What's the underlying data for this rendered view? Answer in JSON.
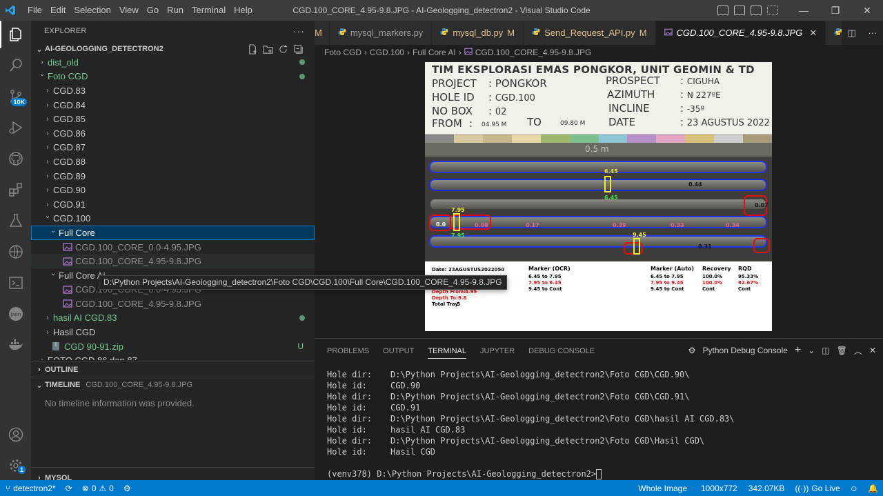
{
  "titlebar": {
    "menu": [
      "File",
      "Edit",
      "Selection",
      "View",
      "Go",
      "Run",
      "Terminal",
      "Help"
    ],
    "title": "CGD.100_CORE_4.95-9.8.JPG - AI-Geologging_detectron2 - Visual Studio Code"
  },
  "activitybar": {
    "items": [
      "explorer-icon",
      "search-icon",
      "source-control-icon",
      "run-debug-icon",
      "github-icon",
      "extensions-icon",
      "testing-icon",
      "remote-explorer-icon",
      "terminal-icon",
      "json-icon",
      "docker-icon",
      "account-icon",
      "settings-icon"
    ],
    "scm_badge": "10K",
    "settings_badge": "1"
  },
  "sidebar": {
    "header": "EXPLORER",
    "root": "AI-GEOLOGGING_DETECTRON2",
    "tree": [
      {
        "label": "dist_old",
        "level": 1,
        "chev": "›",
        "git": true,
        "dot": true
      },
      {
        "label": "Foto CGD",
        "level": 1,
        "chev": "⌄",
        "git": true,
        "dot": true
      },
      {
        "label": "CGD.83",
        "level": 2,
        "chev": "›"
      },
      {
        "label": "CGD.84",
        "level": 2,
        "chev": "›"
      },
      {
        "label": "CGD.85",
        "level": 2,
        "chev": "›"
      },
      {
        "label": "CGD.86",
        "level": 2,
        "chev": "›"
      },
      {
        "label": "CGD.87",
        "level": 2,
        "chev": "›"
      },
      {
        "label": "CGD.88",
        "level": 2,
        "chev": "›"
      },
      {
        "label": "CGD.89",
        "level": 2,
        "chev": "›"
      },
      {
        "label": "CGD.90",
        "level": 2,
        "chev": "›"
      },
      {
        "label": "CGD.91",
        "level": 2,
        "chev": "›"
      },
      {
        "label": "CGD.100",
        "level": 2,
        "chev": "⌄"
      },
      {
        "label": "Full Core",
        "level": 3,
        "chev": "⌄",
        "selected": true
      },
      {
        "label": "CGD.100_CORE_0.0-4.95.JPG",
        "level": 4,
        "file": true,
        "dim": true
      },
      {
        "label": "CGD.100_CORE_4.95-9.8.JPG",
        "level": 4,
        "file": true,
        "dim": true,
        "hover": true
      },
      {
        "label": "Full Core AI",
        "level": 3,
        "chev": "⌄"
      },
      {
        "label": "CGD.100_CORE_0.0-4.95.JPG",
        "level": 4,
        "file": true,
        "dim": true
      },
      {
        "label": "CGD.100_CORE_4.95-9.8.JPG",
        "level": 4,
        "file": true,
        "dim": true
      },
      {
        "label": "hasil AI CGD.83",
        "level": 2,
        "chev": "›",
        "git": true,
        "dot": true
      },
      {
        "label": "Hasil CGD",
        "level": 2,
        "chev": "›"
      },
      {
        "label": "CGD 90-91.zip",
        "level": 2,
        "zip": true,
        "git": true,
        "u": "U"
      },
      {
        "label": "FOTO CGD 86 dan 87",
        "level": 1,
        "chev": "›"
      }
    ],
    "outline": "OUTLINE",
    "timeline": "TIMELINE",
    "timeline_file": "CGD.100_CORE_4.95-9.8.JPG",
    "timeline_empty": "No timeline information was provided.",
    "mysql": "MYSQL"
  },
  "tooltip": "D:\\Python Projects\\AI-Geologging_detectron2\\Foto CGD\\CGD.100\\Full Core\\CGD.100_CORE_4.95-9.8.JPG",
  "tabs": [
    {
      "label": "M",
      "partial": true
    },
    {
      "label": "mysql_markers.py",
      "icon": "python-icon"
    },
    {
      "label": "mysql_db.py",
      "mod": "M",
      "icon": "python-icon"
    },
    {
      "label": "Send_Request_API.py",
      "mod": "M",
      "icon": "python-icon"
    },
    {
      "label": "CGD.100_CORE_4.95-9.8.JPG",
      "icon": "image-icon",
      "active": true
    },
    {
      "label": "fla",
      "icon": "python-icon",
      "partial": true
    }
  ],
  "breadcrumb": [
    "Foto CGD",
    "CGD.100",
    "Full Core AI",
    "CGD.100_CORE_4.95-9.8.JPG"
  ],
  "image": {
    "board_title": "TIM EKSPLORASI EMAS PONGKOR, UNIT GEOMIN & TD",
    "labels": {
      "project": "PROJECT",
      "project_v": "PONGKOR",
      "holeid": "HOLE ID",
      "holeid_v": "CGD.100",
      "nobox": "NO BOX",
      "nobox_v": "02",
      "from": "FROM",
      "from_v": "04.95 M",
      "to": "TO",
      "to_v": "09.80 M",
      "prospect": "PROSPECT",
      "prospect_v": "CIGUHA",
      "azimuth": "AZIMUTH",
      "azimuth_v": "N 227ºE",
      "incline": "INCLINE",
      "incline_v": "-35º",
      "date": "DATE",
      "date_v": "23 AGUSTUS 2022"
    },
    "ruler": "0.5 m",
    "markers": [
      "6.45",
      "6.45",
      "7.95",
      "7.95",
      "9.45",
      "0.0",
      "0.44",
      "0.07",
      "0.31",
      "0.08",
      "0.17",
      "0.39",
      "0.33",
      "0.34"
    ],
    "table_headers": [
      "Marker (OCR)",
      "Marker (Auto)",
      "Recovery",
      "RQD"
    ],
    "table_left": [
      "Date:",
      "23AGUSTUS2022050",
      "Depth From:",
      "4.95",
      "Depth To:",
      "9.8",
      "Total Tray:",
      "5"
    ],
    "ocr_rows": [
      "6.45 to 7.95",
      "7.95 to 9.45",
      "9.45 to Cont"
    ],
    "auto_rows": [
      "6.45 to 7.95",
      "7.95 to 9.45",
      "9.45 to Cont"
    ],
    "recovery": [
      "100.0%",
      "100.0%",
      "Cont"
    ],
    "rqd": [
      "95.33%",
      "92.67%",
      "Cont"
    ]
  },
  "panel": {
    "tabs": [
      "PROBLEMS",
      "OUTPUT",
      "TERMINAL",
      "JUPYTER",
      "DEBUG CONSOLE"
    ],
    "active_tab": "TERMINAL",
    "console_name": "Python Debug Console",
    "lines": [
      {
        "k": "Hole dir:",
        "v": "D:\\Python Projects\\AI-Geologging_detectron2\\Foto CGD\\CGD.90\\"
      },
      {
        "k": "Hole id:",
        "v": "CGD.90"
      },
      {
        "k": "Hole dir:",
        "v": "D:\\Python Projects\\AI-Geologging_detectron2\\Foto CGD\\CGD.91\\"
      },
      {
        "k": "Hole id:",
        "v": "CGD.91"
      },
      {
        "k": "Hole dir:",
        "v": "D:\\Python Projects\\AI-Geologging_detectron2\\Foto CGD\\hasil AI CGD.83\\"
      },
      {
        "k": "Hole id:",
        "v": "hasil AI CGD.83"
      },
      {
        "k": "Hole dir:",
        "v": "D:\\Python Projects\\AI-Geologging_detectron2\\Foto CGD\\Hasil CGD\\"
      },
      {
        "k": "Hole id:",
        "v": "Hasil CGD"
      }
    ],
    "prompt": "(venv378) D:\\Python Projects\\AI-Geologging_detectron2>"
  },
  "statusbar": {
    "branch": "detectron2*",
    "errors": "0",
    "warnings": "0",
    "mode": "Whole Image",
    "dimensions": "1000x772",
    "size": "342.07KB",
    "golive": "Go Live"
  }
}
